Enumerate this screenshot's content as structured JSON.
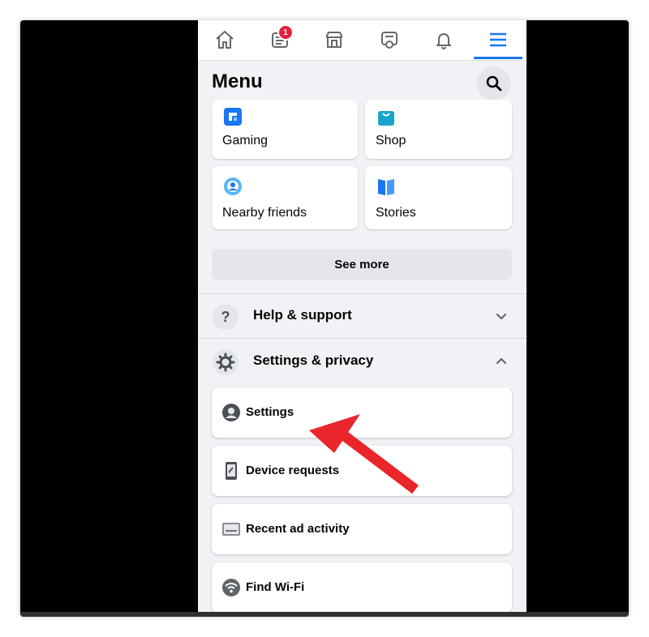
{
  "nav": {
    "items": [
      {
        "icon": "home-icon"
      },
      {
        "icon": "news-feed-icon",
        "badge": "1"
      },
      {
        "icon": "marketplace-icon"
      },
      {
        "icon": "watch-icon"
      },
      {
        "icon": "bell-icon"
      },
      {
        "icon": "hamburger-menu-icon",
        "active": true
      }
    ]
  },
  "header": {
    "title": "Menu",
    "search_icon": "search-icon"
  },
  "shortcuts": [
    {
      "label": "Gaming",
      "icon": "gaming-icon"
    },
    {
      "label": "Shop",
      "icon": "shop-icon"
    },
    {
      "label": "Nearby friends",
      "icon": "nearby-friends-icon"
    },
    {
      "label": "Stories",
      "icon": "stories-icon"
    }
  ],
  "see_more_label": "See more",
  "help": {
    "label": "Help & support",
    "icon": "question-icon",
    "expanded": false
  },
  "settings_privacy": {
    "label": "Settings & privacy",
    "icon": "gear-icon",
    "expanded": true,
    "items": [
      {
        "label": "Settings",
        "icon": "account-settings-icon"
      },
      {
        "label": "Device requests",
        "icon": "device-icon"
      },
      {
        "label": "Recent ad activity",
        "icon": "ad-activity-icon"
      },
      {
        "label": "Find Wi-Fi",
        "icon": "wifi-icon"
      }
    ]
  },
  "annotation": {
    "type": "red-arrow",
    "points_to": "Settings",
    "color": "#e8262b"
  },
  "colors": {
    "accent": "#1877f2",
    "badge": "#e41e3f",
    "background": "#f0f2f5",
    "card": "#ffffff"
  }
}
